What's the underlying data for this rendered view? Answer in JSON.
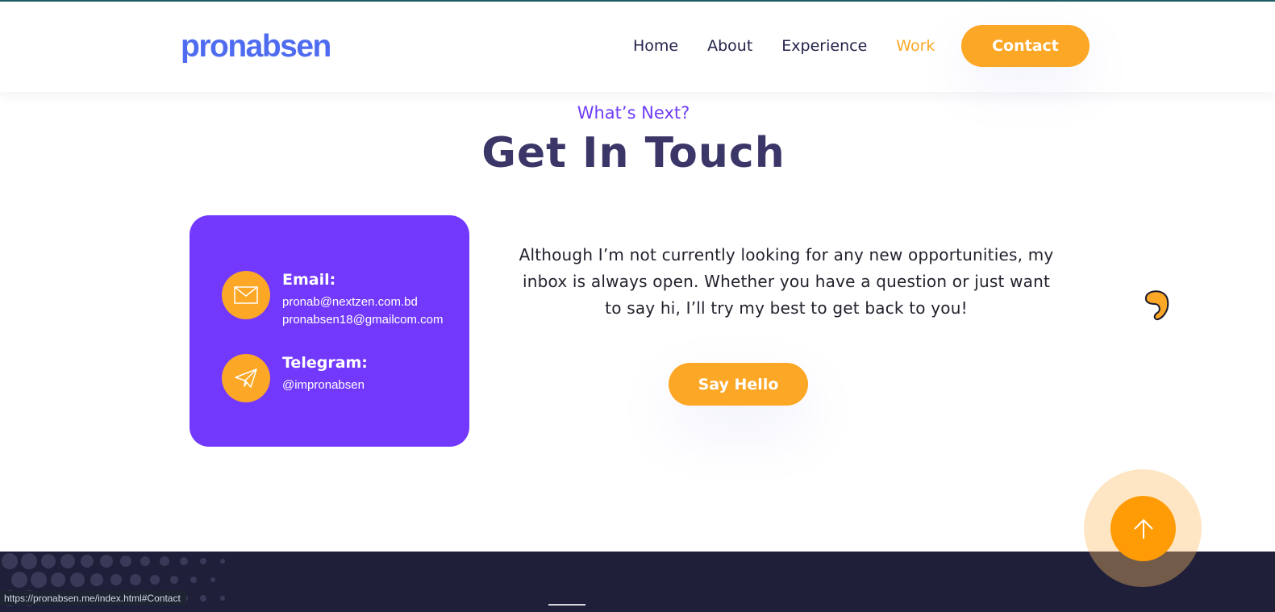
{
  "brand": {
    "logo_text": "pronabsen",
    "logo_color": "#4f6cf0"
  },
  "nav": {
    "items": [
      {
        "label": "Home",
        "active": false
      },
      {
        "label": "About",
        "active": false
      },
      {
        "label": "Experience",
        "active": false
      },
      {
        "label": "Work",
        "active": true
      }
    ],
    "contact_button": "Contact"
  },
  "section": {
    "eyebrow": "What’s Next?",
    "title": "Get In Touch",
    "paragraph": "Although I’m not currently looking for any new opportunities, my inbox is always open. Whether you have a question or just want to say hi, I’ll try my best to get back to you!",
    "cta_label": "Say Hello"
  },
  "contact_card": {
    "email_label": "Email:",
    "emails": [
      "pronab@nextzen.com.bd",
      "pronabsen18@gmailcom.com"
    ],
    "telegram_label": "Telegram:",
    "telegram_handle": "@impronabsen"
  },
  "status_bar": {
    "url": "https://pronabsen.me/index.html#Contact"
  },
  "icons": {
    "email": "envelope-icon",
    "telegram": "paper-plane-icon",
    "scroll_top": "arrow-up-icon",
    "decoration": "swirl-icon"
  },
  "colors": {
    "accent": "#fca726",
    "card": "#7239fd",
    "title": "#3b3668",
    "eyebrow": "#6f3cf7",
    "footer": "#201f3a"
  }
}
